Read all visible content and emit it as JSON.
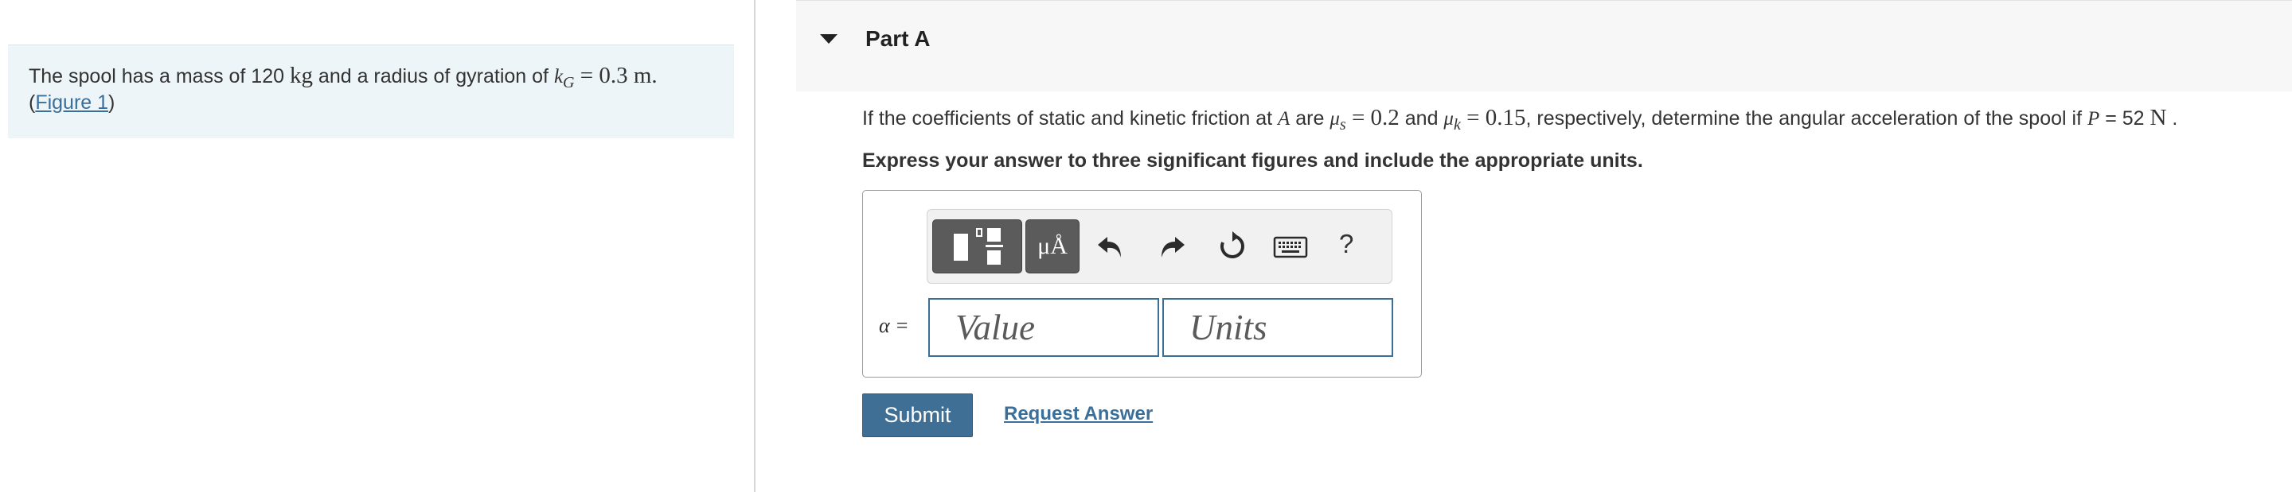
{
  "problem": {
    "text_before_mass": "The spool has a mass of 120 ",
    "mass_unit": "kg",
    "text_after_mass": " and a radius of gyration of ",
    "k_symbol": "k",
    "k_subscript": "G",
    "k_equals_value": " = 0.3 m.",
    "figure_open": "(",
    "figure_link": "Figure 1",
    "figure_close": ")"
  },
  "part": {
    "title": "Part A"
  },
  "question": {
    "q1": "If the coefficients of static and kinetic friction at ",
    "point": "A",
    "q2": " are ",
    "mu": "μ",
    "s_sub": "s",
    "mu_s_value": " = 0.2",
    "q3": " and ",
    "k_sub": "k",
    "mu_k_value": " = 0.15",
    "q4": ", respectively, determine the angular acceleration of the spool if ",
    "p_symbol": "P",
    "p_value": " = 52 ",
    "p_unit": "N",
    "q5": " ."
  },
  "instruction": "Express your answer to three significant figures and include the appropriate units.",
  "answer": {
    "units_button_label": "μÅ",
    "help_label": "?",
    "variable_label": "α =",
    "value_placeholder": "Value",
    "units_placeholder": "Units",
    "value": "",
    "units": ""
  },
  "actions": {
    "submit_label": "Submit",
    "request_answer_label": "Request Answer"
  },
  "icons": {
    "collapse": "caret-down-icon",
    "templates": "templates-icon",
    "undo": "undo-icon",
    "redo": "redo-icon",
    "reset": "reset-icon",
    "keyboard": "keyboard-icon",
    "help": "help-icon"
  },
  "colors": {
    "primary": "#3f6f94",
    "link": "#3a6f9b",
    "panel_bg": "#edf5f8",
    "header_bg": "#f7f7f7",
    "toolbar_dark": "#5b5b5b"
  }
}
